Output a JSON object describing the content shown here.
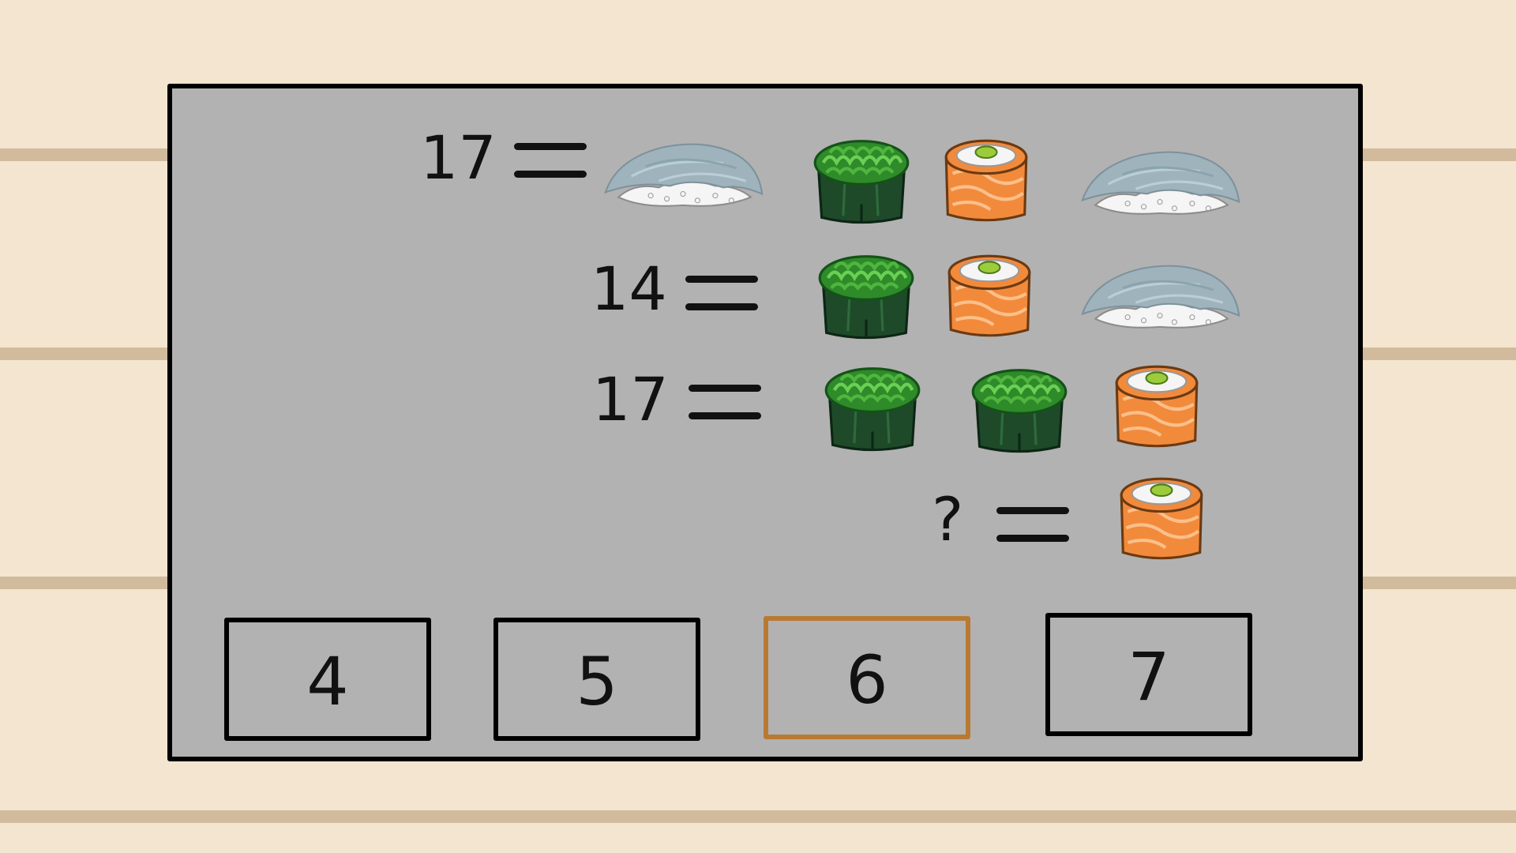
{
  "equations": [
    {
      "result": "17",
      "items": [
        "nigiri",
        "seaweed-gunkan",
        "salmon-roll",
        "nigiri"
      ]
    },
    {
      "result": "14",
      "items": [
        "seaweed-gunkan",
        "salmon-roll",
        "nigiri"
      ]
    },
    {
      "result": "17",
      "items": [
        "seaweed-gunkan",
        "seaweed-gunkan",
        "salmon-roll"
      ]
    },
    {
      "result": "?",
      "items": [
        "salmon-roll"
      ]
    }
  ],
  "answers": [
    "4",
    "5",
    "6",
    "7"
  ],
  "selected_answer": "6",
  "colors": {
    "background": "#f3e5cf",
    "stripe": "#d1bb9c",
    "panel": "#b2b2b2",
    "selected_border": "#b87a33",
    "salmon": "#f28a3c",
    "seaweed": "#1f4a2a",
    "fish_top": "#9fb3bc"
  }
}
